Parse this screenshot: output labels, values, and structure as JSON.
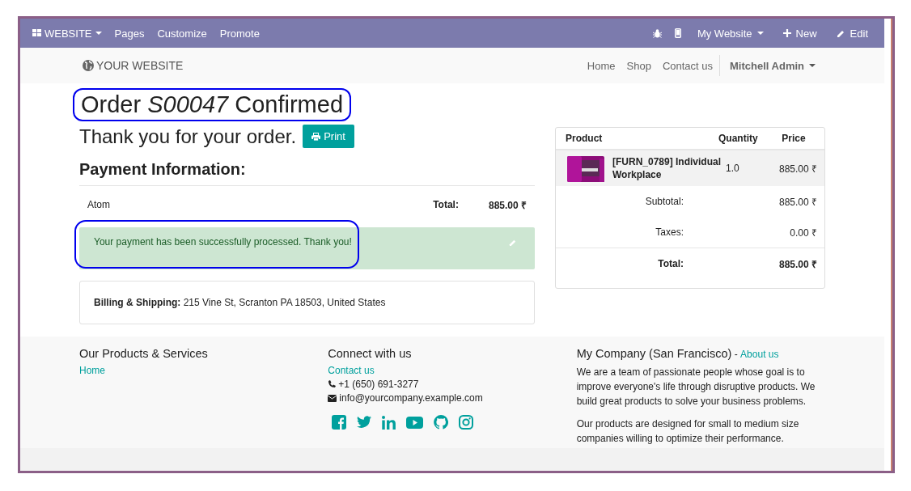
{
  "top_bar": {
    "app_menu": "WEBSITE",
    "menu": [
      "Pages",
      "Customize",
      "Promote"
    ],
    "website_switcher": "My Website",
    "new_button": "New",
    "edit_button": "Edit"
  },
  "header": {
    "logo": "YOUR WEBSITE",
    "nav": [
      "Home",
      "Shop",
      "Contact us"
    ],
    "user": "Mitchell Admin"
  },
  "order": {
    "title": "Order *S00047* Confirmed",
    "highlighted": true,
    "thank_you": "Thank you for your order.",
    "print_button": "Print"
  },
  "payment": {
    "heading": "Payment Information:",
    "method": "Atom",
    "total_label": "Total:",
    "total": "885.00 ₹"
  },
  "alert": {
    "message": "Your payment has been successfully processed. Thank you!",
    "highlighted": true
  },
  "address": "**Billing & Shipping:** 215 Vine St, Scranton PA 18503, United States",
  "summary": {
    "columns": [
      "Product",
      "Quantity",
      "Price"
    ],
    "lines": [
      {
        "product": "[FURN_0789] Individual Workplace",
        "quantity": "1.0",
        "price": "885.00 ₹"
      }
    ],
    "totals": [
      {
        "kind": "subtotal",
        "label": "Subtotal:",
        "value": "885.00 ₹"
      },
      {
        "kind": "taxes",
        "label": "Taxes:",
        "value": "0.00 ₹"
      },
      {
        "kind": "total",
        "label": "Total:",
        "value": "885.00 ₹"
      }
    ]
  },
  "footer": {
    "products": {
      "heading": "Our Products & Services",
      "links": [
        "Home"
      ]
    },
    "connect": {
      "heading": "Connect with us",
      "link": "Contact us",
      "phone": "+1 (650) 691-3277",
      "email": "info@yourcompany.example.com"
    },
    "company": {
      "heading": "My Company (San Francisco)",
      "separator": " - ",
      "link": "About us",
      "paragraphs": [
        "We are a team of passionate people whose goal is to improve everyone's life through disruptive products. We build great products to solve your business problems.",
        "Our products are designed for small to medium size companies willing to optimize their performance."
      ]
    }
  }
}
